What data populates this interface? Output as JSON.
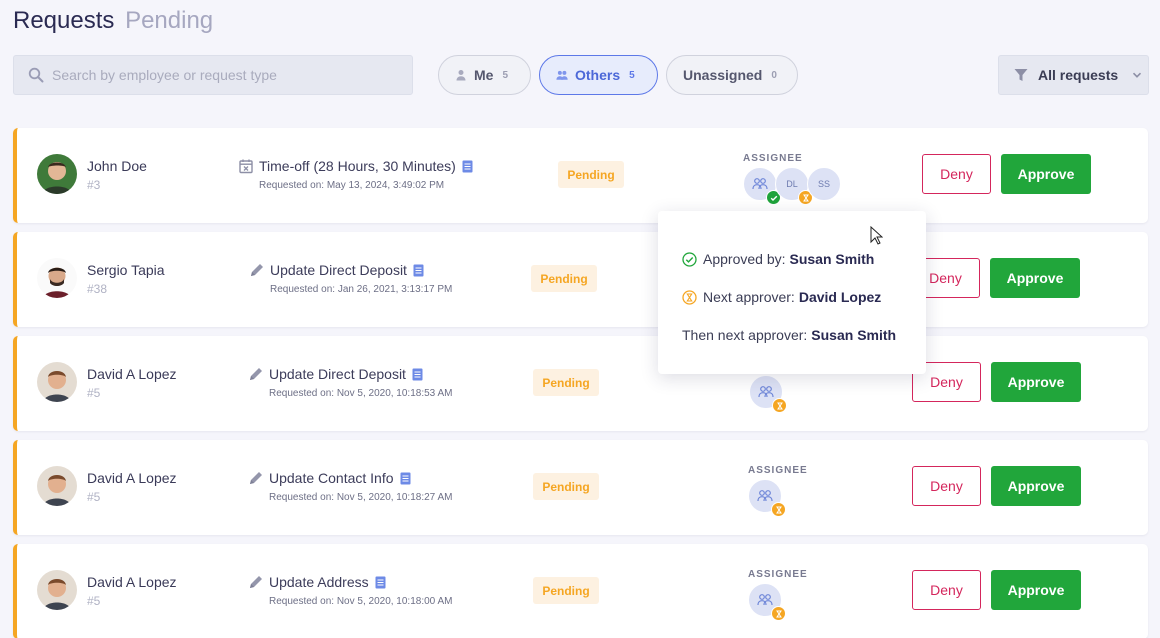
{
  "header": {
    "title": "Requests",
    "subtitle": "Pending"
  },
  "search": {
    "placeholder": "Search by employee or request type",
    "value": ""
  },
  "filters": [
    {
      "label": "Me",
      "count": "5",
      "icon": "person-icon",
      "active": false
    },
    {
      "label": "Others",
      "count": "5",
      "icon": "people-icon",
      "active": true
    },
    {
      "label": "Unassigned",
      "count": "0",
      "icon": "",
      "active": false
    }
  ],
  "dropdown": {
    "label": "All requests"
  },
  "colors": {
    "accent": "#5d78e8",
    "pending": "#f5a623",
    "approve": "#21a63b",
    "deny": "#d4265c"
  },
  "requests": [
    {
      "name": "John Doe",
      "id": "#3",
      "type_icon": "calendar-x-icon",
      "title": "Time-off (28 Hours, 30 Minutes)",
      "requested_on": "Requested on: May 13, 2024, 3:49:02 PM",
      "status": "Pending",
      "assignee_label": "ASSIGNEE",
      "assignees": [
        {
          "initials": "",
          "kind": "group",
          "state": "approved"
        },
        {
          "initials": "DL",
          "kind": "person",
          "state": "waiting"
        },
        {
          "initials": "SS",
          "kind": "person",
          "state": ""
        }
      ],
      "deny": "Deny",
      "approve": "Approve"
    },
    {
      "name": "Sergio Tapia",
      "id": "#38",
      "type_icon": "pencil-icon",
      "title": "Update Direct Deposit",
      "requested_on": "Requested on: Jan 26, 2021, 3:13:17 PM",
      "status": "Pending",
      "assignee_label": "",
      "assignees": [],
      "deny": "Deny",
      "approve": "Approve"
    },
    {
      "name": "David A Lopez",
      "id": "#5",
      "type_icon": "pencil-icon",
      "title": "Update Direct Deposit",
      "requested_on": "Requested on: Nov 5, 2020, 10:18:53 AM",
      "status": "Pending",
      "assignee_label": "",
      "assignees": [
        {
          "initials": "",
          "kind": "group",
          "state": "waiting"
        }
      ],
      "deny": "Deny",
      "approve": "Approve"
    },
    {
      "name": "David A Lopez",
      "id": "#5",
      "type_icon": "pencil-icon",
      "title": "Update Contact Info",
      "requested_on": "Requested on: Nov 5, 2020, 10:18:27 AM",
      "status": "Pending",
      "assignee_label": "ASSIGNEE",
      "assignees": [
        {
          "initials": "",
          "kind": "group",
          "state": "waiting"
        }
      ],
      "deny": "Deny",
      "approve": "Approve"
    },
    {
      "name": "David A Lopez",
      "id": "#5",
      "type_icon": "pencil-icon",
      "title": "Update Address",
      "requested_on": "Requested on: Nov 5, 2020, 10:18:00 AM",
      "status": "Pending",
      "assignee_label": "ASSIGNEE",
      "assignees": [
        {
          "initials": "",
          "kind": "group",
          "state": "waiting"
        }
      ],
      "deny": "Deny",
      "approve": "Approve"
    }
  ],
  "popover": {
    "approved_label": "Approved by:",
    "approved_name": "Susan Smith",
    "next_label": "Next approver:",
    "next_name": "David Lopez",
    "then_label": "Then next approver:",
    "then_name": "Susan Smith"
  }
}
